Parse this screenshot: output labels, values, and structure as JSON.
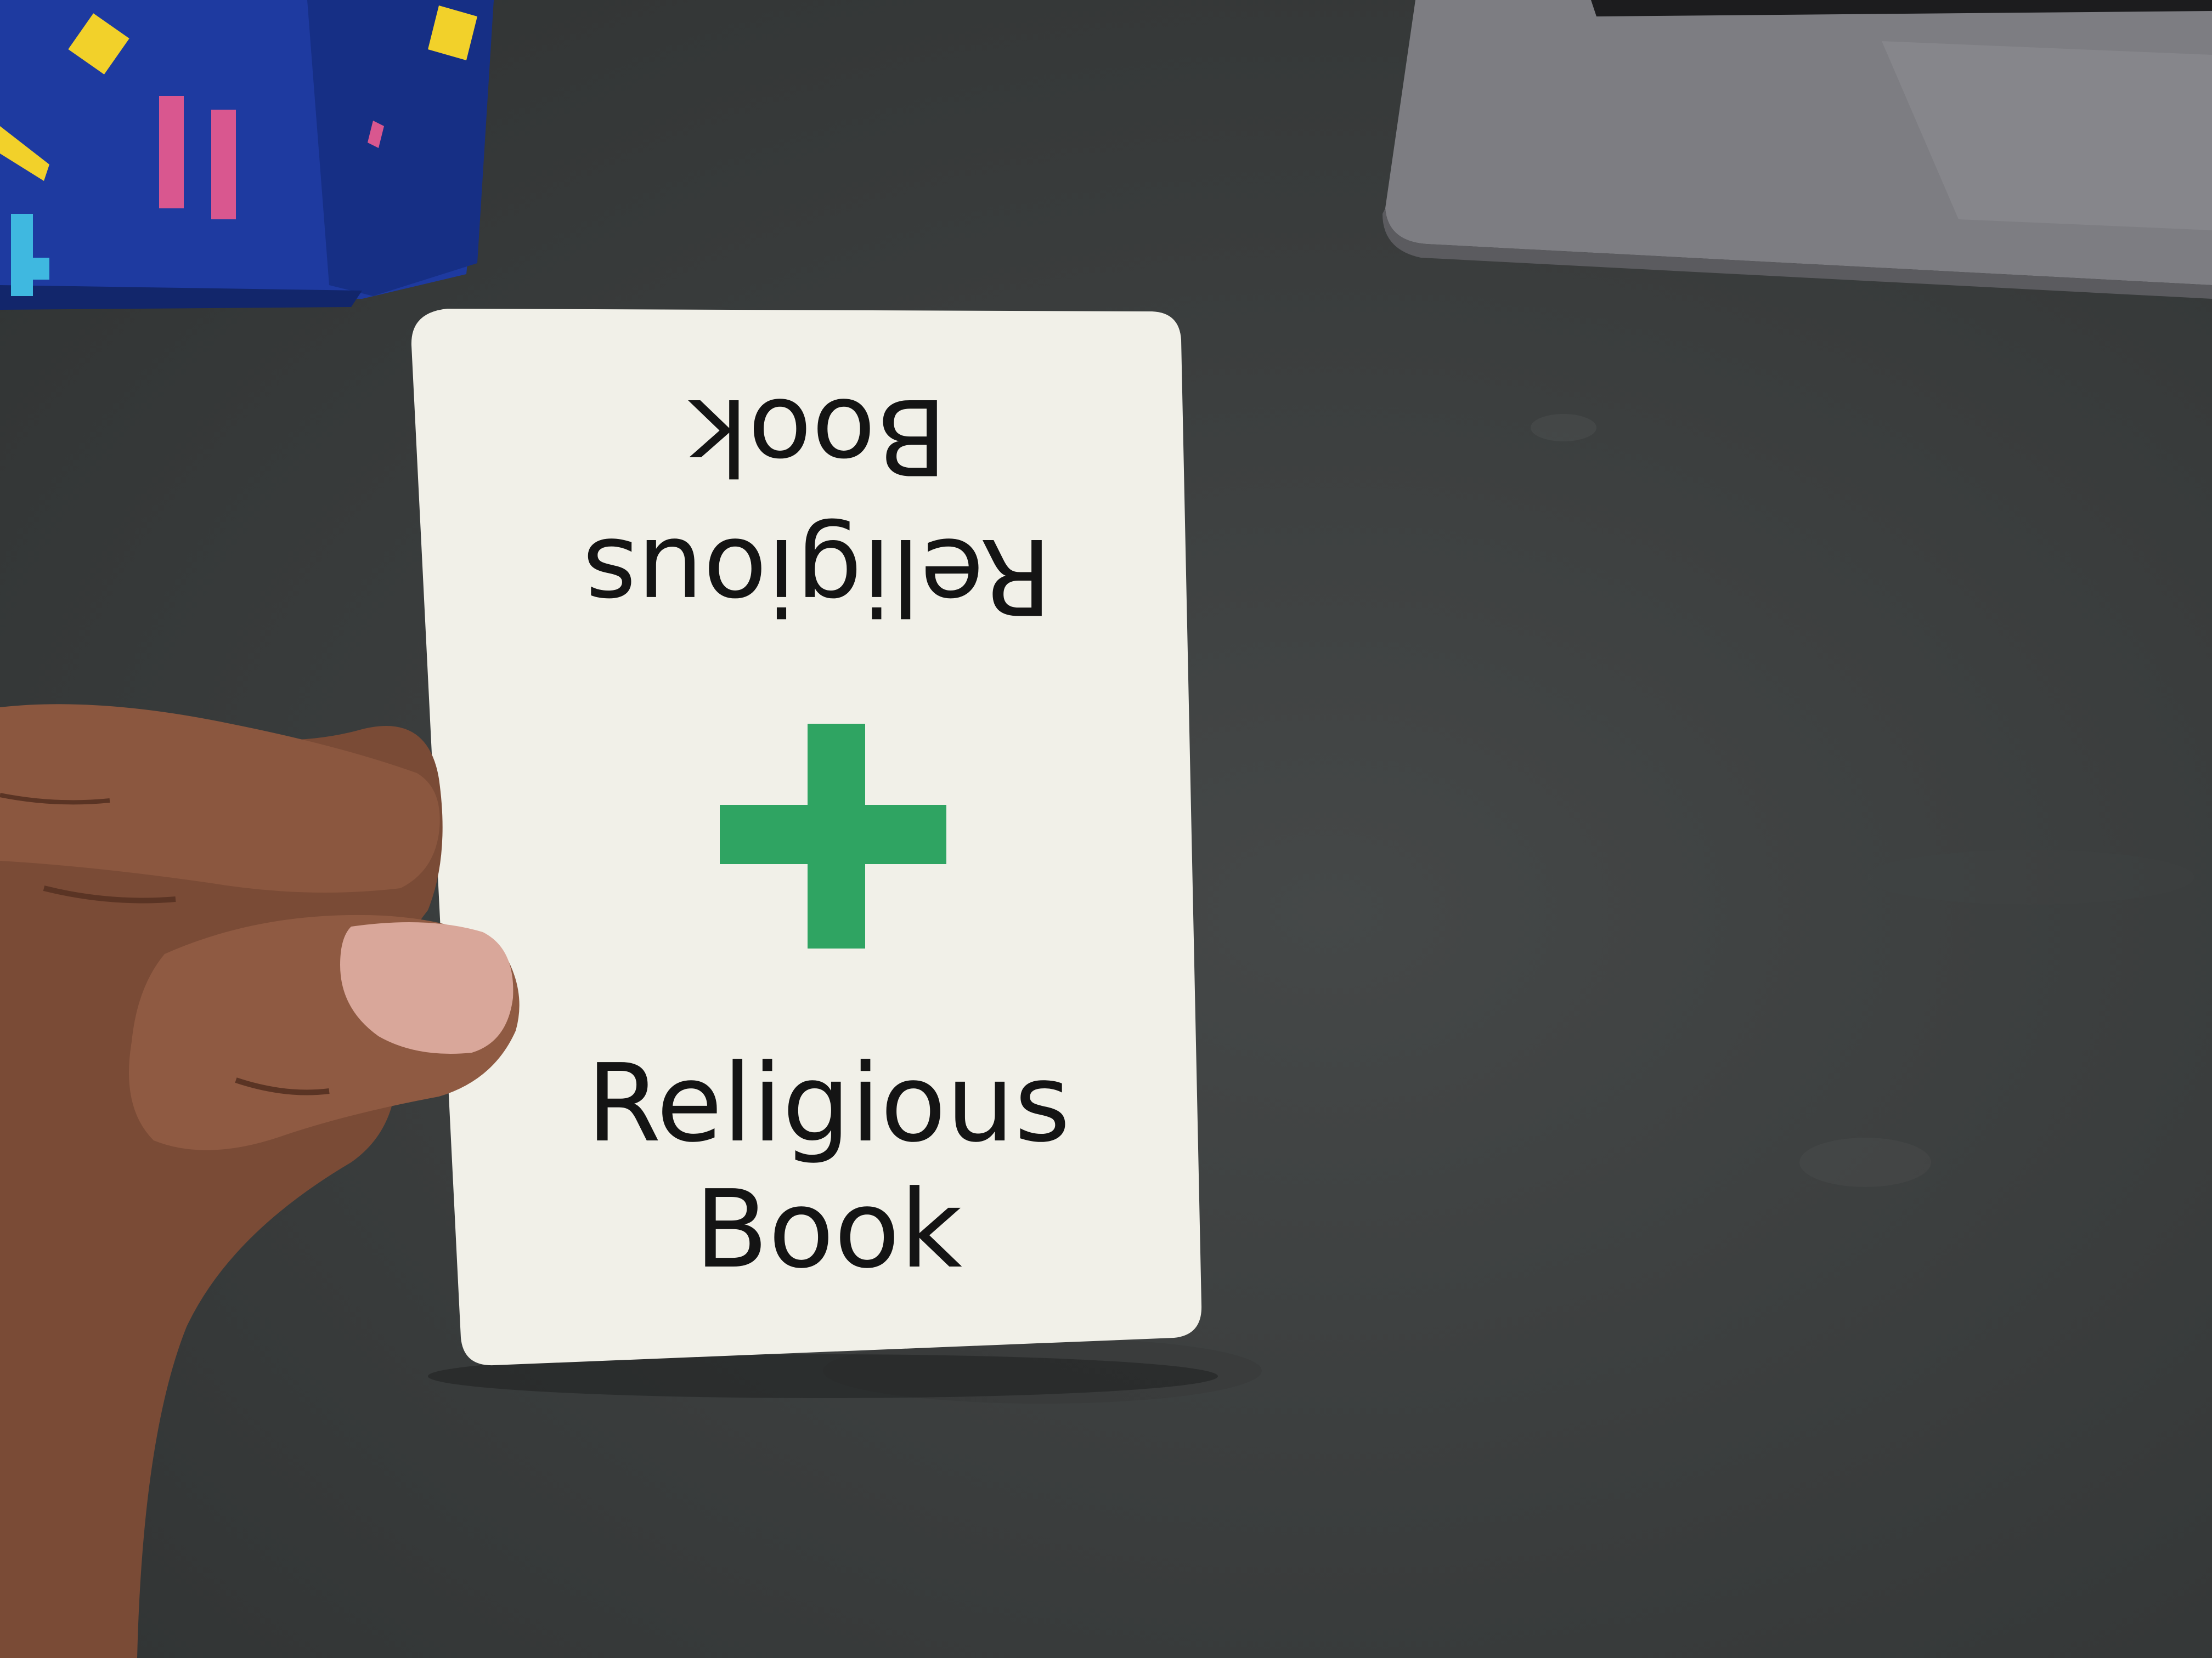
{
  "card": {
    "title_line1": "Religious",
    "title_line2": "Book",
    "symbol": "plus-icon",
    "symbol_color": "#2fa462",
    "card_color": "#f1f0e8",
    "text_color": "#141414"
  },
  "scene": {
    "surface_color": "#3a3d3d",
    "box_color": "#1f3a9e",
    "laptop_color": "#7c7c80"
  }
}
